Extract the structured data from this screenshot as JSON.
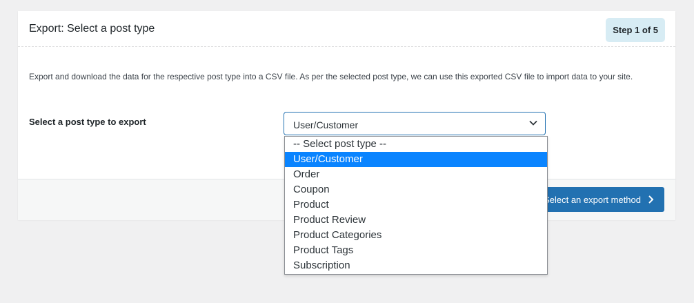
{
  "header": {
    "title": "Export: Select a post type",
    "step_badge": "Step 1 of 5"
  },
  "main": {
    "description": "Export and download the data for the respective post type into a CSV file. As per the selected post type, we can use this exported CSV file to import data to your site.",
    "field_label": "Select a post type to export",
    "select": {
      "value": "User/Customer",
      "options": [
        {
          "label": "-- Select post type --",
          "selected": false
        },
        {
          "label": "User/Customer",
          "selected": true
        },
        {
          "label": "Order",
          "selected": false
        },
        {
          "label": "Coupon",
          "selected": false
        },
        {
          "label": "Product",
          "selected": false
        },
        {
          "label": "Product Review",
          "selected": false
        },
        {
          "label": "Product Categories",
          "selected": false
        },
        {
          "label": "Product Tags",
          "selected": false
        },
        {
          "label": "Subscription",
          "selected": false
        }
      ]
    }
  },
  "footer": {
    "next_button_label": "Step 2: Select an export method",
    "next_button_icon": "chevron-right-icon"
  },
  "colors": {
    "accent": "#2271b1",
    "highlight": "#0a84ff",
    "badge_bg": "#d7ecf4"
  }
}
